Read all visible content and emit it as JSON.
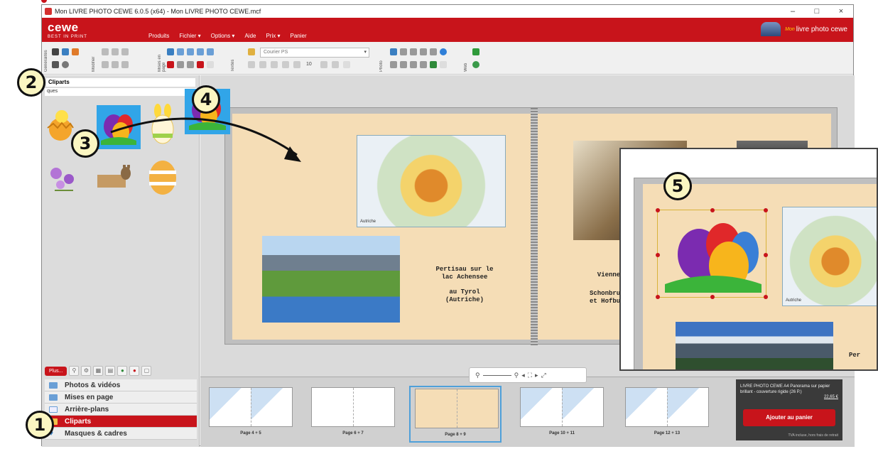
{
  "window": {
    "title": "Mon LIVRE PHOTO CEWE 6.0.5 (x64) - Mon LIVRE PHOTO CEWE.mcf",
    "controls": [
      "–",
      "□",
      "×"
    ]
  },
  "brand": {
    "name": "cewe",
    "tagline": "BEST IN PRINT",
    "right_logo_small": "Mon",
    "right_logo_big": "livre photo cewe"
  },
  "menu": [
    "Produits",
    "Fichier",
    "Options",
    "Aide",
    "Prix",
    "Panier"
  ],
  "toolbar": {
    "groups": [
      "Généralités",
      "Modifier",
      "Mises en page",
      "Textes",
      "Photo",
      "Web"
    ],
    "font": "Courier PS",
    "font_size": "10"
  },
  "left_panel": {
    "title": "Cliparts",
    "subtitle": "ques",
    "plus_button": "Plus...",
    "nav": [
      {
        "label": "Photos & vidéos",
        "icon": "photo-icon"
      },
      {
        "label": "Mises en page",
        "icon": "layout-icon"
      },
      {
        "label": "Arrière-plans",
        "icon": "background-icon"
      },
      {
        "label": "Cliparts",
        "icon": "clipart-icon"
      },
      {
        "label": "Masques & cadres",
        "icon": "heart-icon"
      }
    ]
  },
  "page": {
    "left_caption_1": "Pertisau  sur le\nlac Achensee",
    "left_caption_2": "au Tyrol\n(Autriche)",
    "map_caption": "Autriche",
    "right_caption_1": "Vienne",
    "right_caption_2": "Schonbrunn\net Hofburg",
    "zoom_map_caption": "Autriche",
    "zoom_caption": "Per"
  },
  "filmstrip": [
    {
      "label": "Page 4 + 5",
      "active": false
    },
    {
      "label": "Page 6 + 7",
      "active": false
    },
    {
      "label": "Page 8 + 9",
      "active": true
    },
    {
      "label": "Page 10 + 11",
      "active": false
    },
    {
      "label": "Page 12 + 13",
      "active": false
    }
  ],
  "cart": {
    "description": "LIVRE PHOTO CEWE A4 Panorama sur papier brillant - couverture rigide (26 P.)",
    "price": "22,65 €",
    "add_button": "Ajouter au panier",
    "tva_note": "TVA incluse, hors frais de retrait"
  },
  "callouts": [
    "1",
    "2",
    "3",
    "4",
    "5"
  ],
  "colors": {
    "brand_red": "#c8141b",
    "accent_blue": "#4fa0d9",
    "page_bg": "#f5ddb6"
  }
}
